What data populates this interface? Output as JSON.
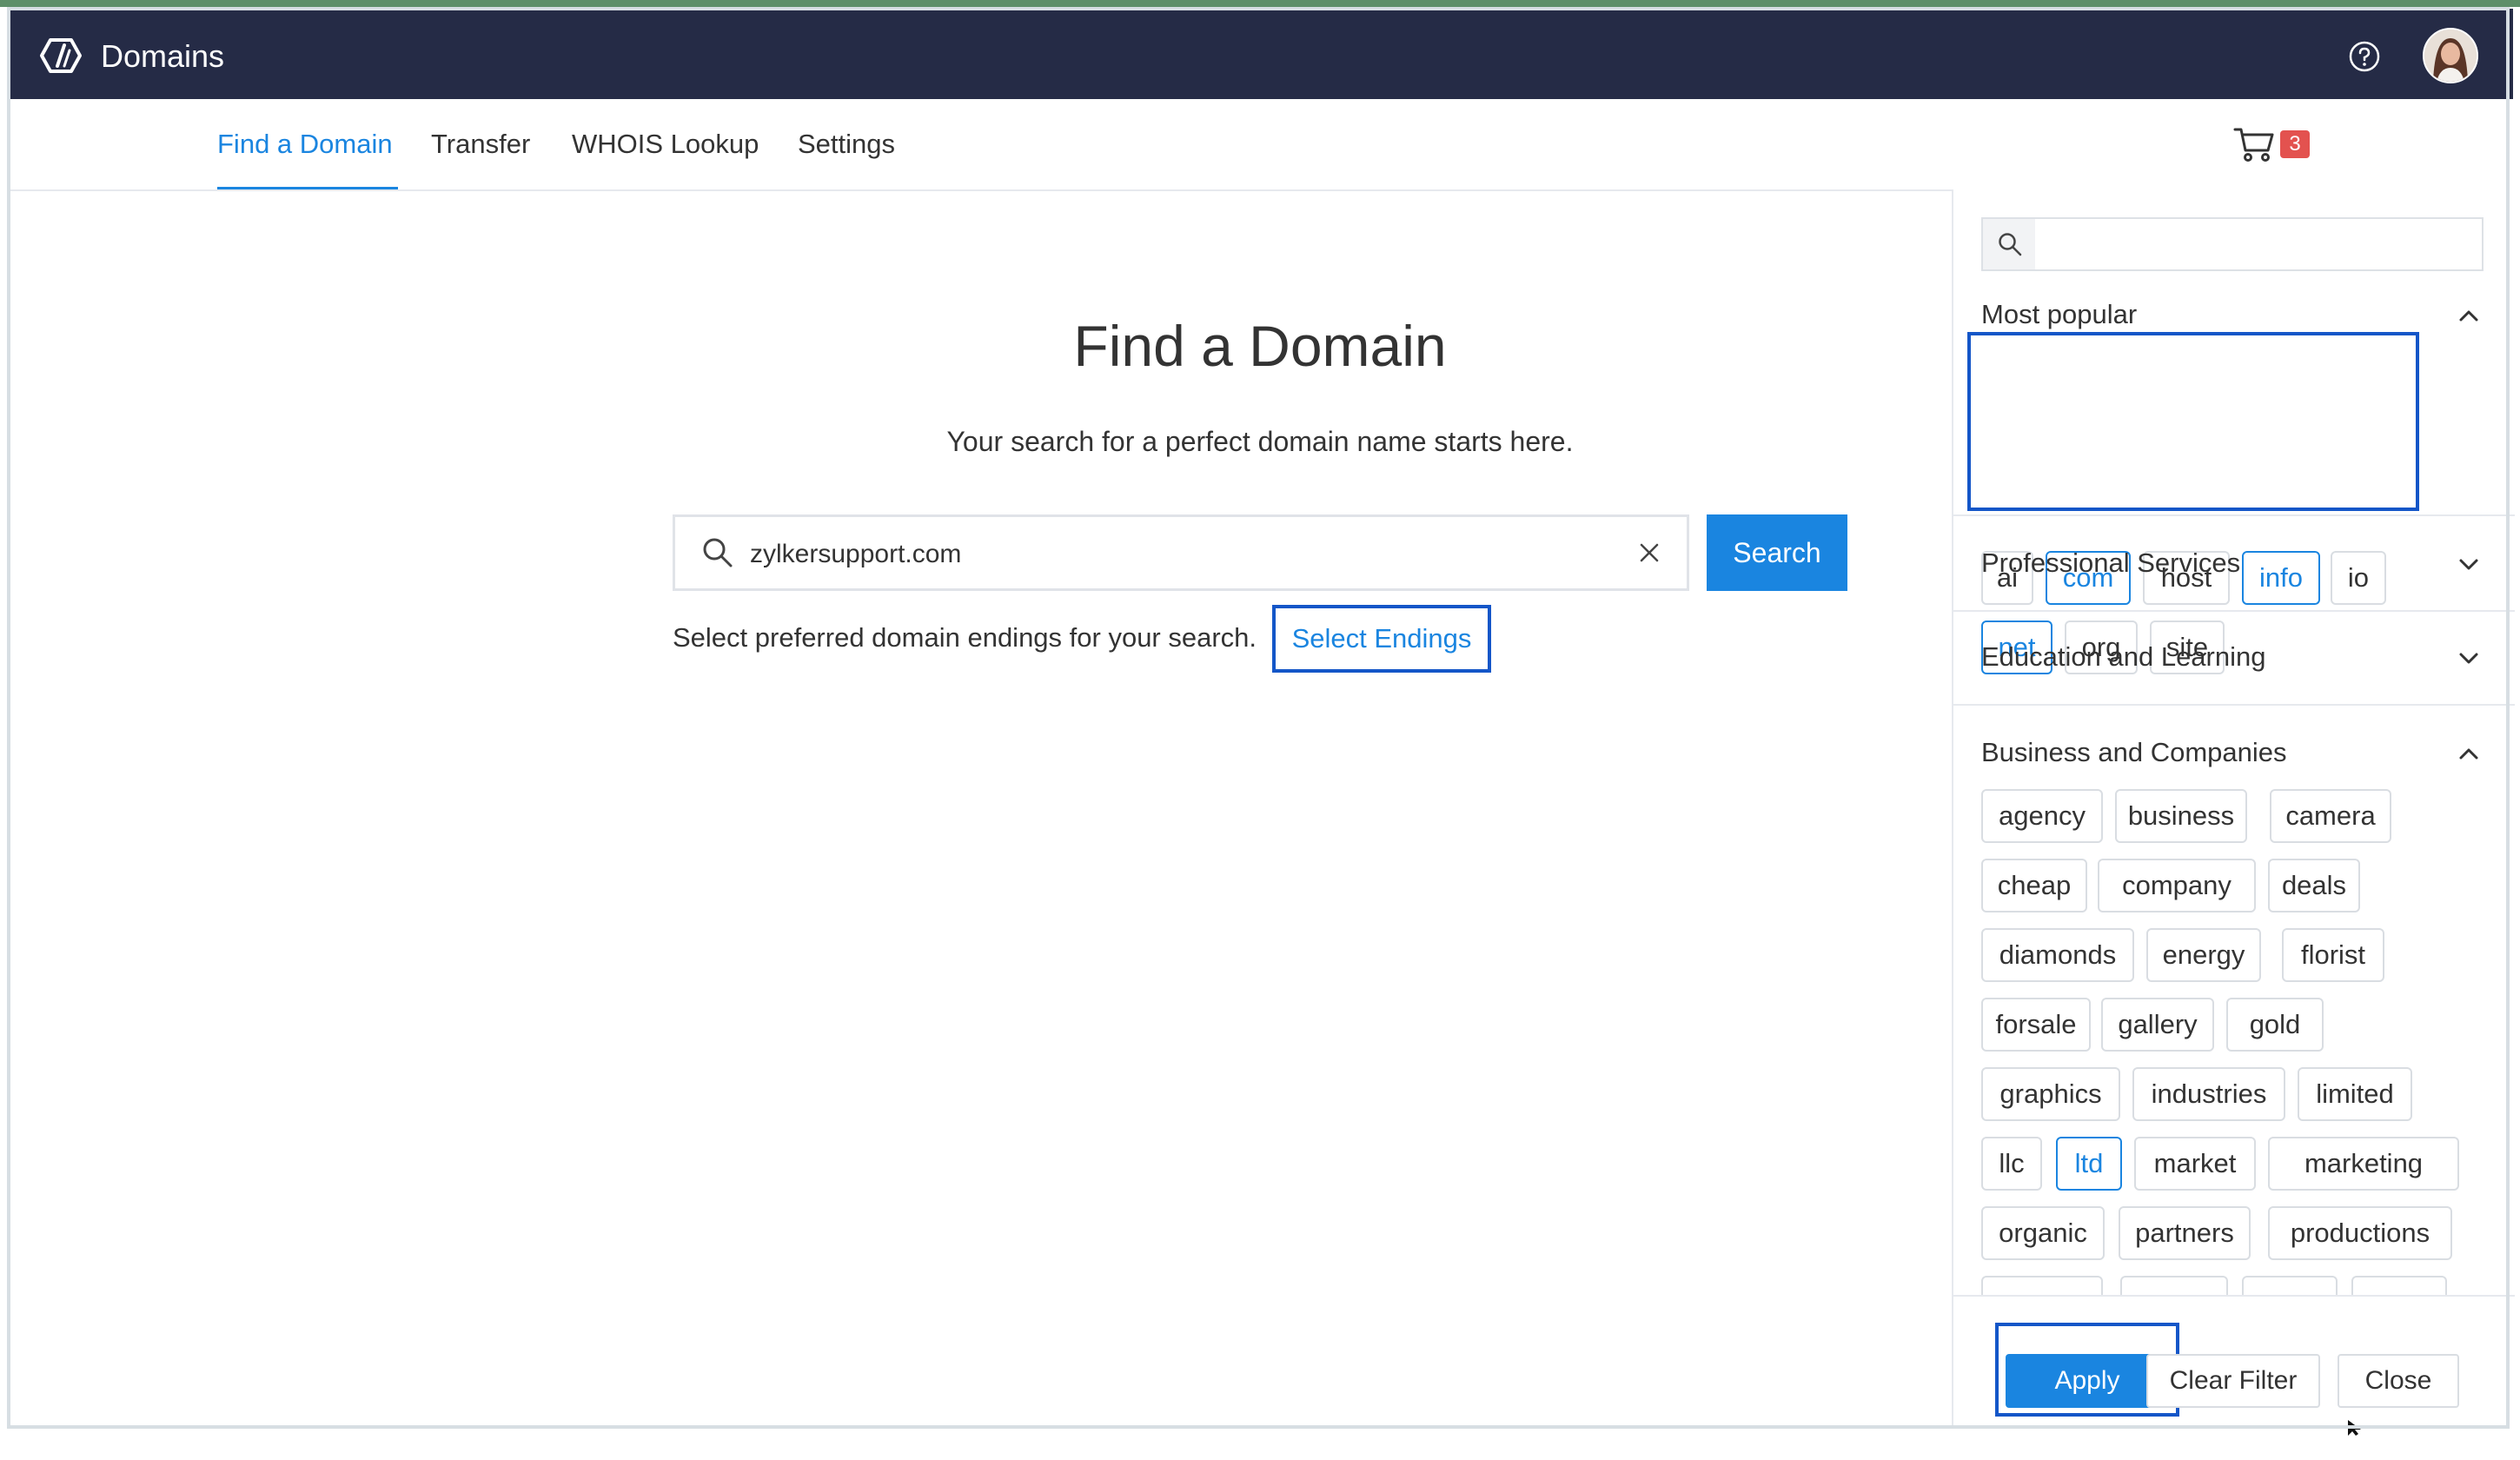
{
  "app": {
    "title": "Domains"
  },
  "header": {
    "help_icon": "help-icon",
    "avatar": "user-avatar"
  },
  "nav": {
    "tabs": [
      {
        "label": "Find a Domain",
        "active": true
      },
      {
        "label": "Transfer",
        "active": false
      },
      {
        "label": "WHOIS Lookup",
        "active": false
      },
      {
        "label": "Settings",
        "active": false
      }
    ],
    "cart_count": "3"
  },
  "main": {
    "title": "Find a Domain",
    "subtitle": "Your search for a perfect domain name starts here.",
    "search_value": "zylkersupport.com",
    "search_button": "Search",
    "endings_text": "Select preferred domain endings for your search.",
    "select_endings": "Select Endings"
  },
  "filter_panel": {
    "search_placeholder": "",
    "sections": {
      "most_popular": "Most popular",
      "professional": "Professional Services",
      "education": "Education and Learning",
      "business": "Business and Companies"
    },
    "popular_chips": [
      {
        "label": "ai",
        "selected": false
      },
      {
        "label": "com",
        "selected": true
      },
      {
        "label": "host",
        "selected": false
      },
      {
        "label": "info",
        "selected": true
      },
      {
        "label": "io",
        "selected": false
      },
      {
        "label": "net",
        "selected": true
      },
      {
        "label": "org",
        "selected": false
      },
      {
        "label": "site",
        "selected": false
      }
    ],
    "business_chips": [
      {
        "label": "agency",
        "selected": false
      },
      {
        "label": "business",
        "selected": false
      },
      {
        "label": "camera",
        "selected": false
      },
      {
        "label": "cheap",
        "selected": false
      },
      {
        "label": "company",
        "selected": false
      },
      {
        "label": "deals",
        "selected": false
      },
      {
        "label": "diamonds",
        "selected": false
      },
      {
        "label": "energy",
        "selected": false
      },
      {
        "label": "florist",
        "selected": false
      },
      {
        "label": "forsale",
        "selected": false
      },
      {
        "label": "gallery",
        "selected": false
      },
      {
        "label": "gold",
        "selected": false
      },
      {
        "label": "graphics",
        "selected": false
      },
      {
        "label": "industries",
        "selected": false
      },
      {
        "label": "limited",
        "selected": false
      },
      {
        "label": "llc",
        "selected": false
      },
      {
        "label": "ltd",
        "selected": true
      },
      {
        "label": "market",
        "selected": false
      },
      {
        "label": "marketing",
        "selected": false
      },
      {
        "label": "organic",
        "selected": false
      },
      {
        "label": "partners",
        "selected": false
      },
      {
        "label": "productions",
        "selected": false
      }
    ],
    "buttons": {
      "apply": "Apply",
      "clear": "Clear Filter",
      "close": "Close"
    }
  },
  "colors": {
    "accent": "#1a85e0",
    "header_bg": "#252b46",
    "highlight": "#1456c8",
    "badge": "#e3524f"
  }
}
